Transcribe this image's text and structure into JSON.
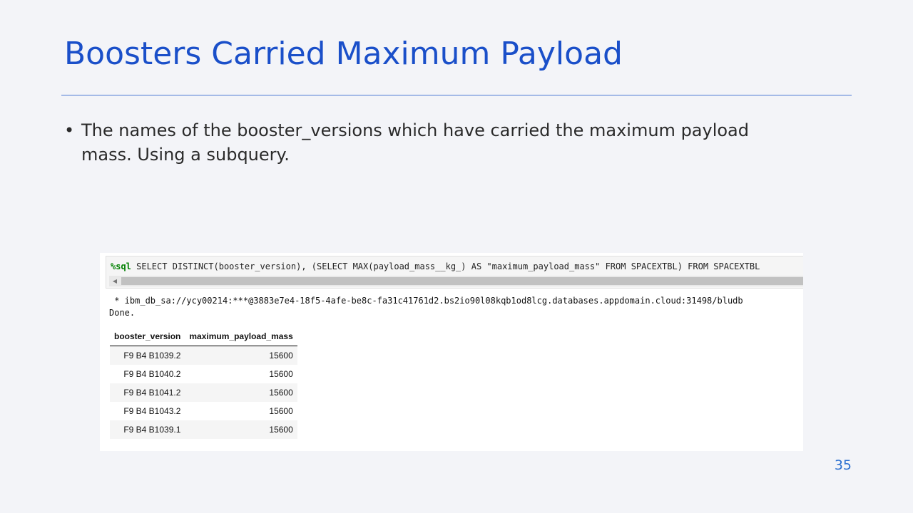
{
  "slide": {
    "title": "Boosters Carried Maximum Payload",
    "bullets": [
      "The names of the booster_versions which have carried the maximum payload mass. Using a subquery."
    ],
    "page_number": "35"
  },
  "notebook": {
    "code": {
      "magic": "%sql",
      "query": " SELECT DISTINCT(booster_version), (SELECT MAX(payload_mass__kg_) AS \"maximum_payload_mass\" FROM SPACEXTBL) FROM SPACEXTBL"
    },
    "output": {
      "connection": " * ibm_db_sa://ycy00214:***@3883e7e4-18f5-4afe-be8c-fa31c41761d2.bs2io90l08kqb1od8lcg.databases.appdomain.cloud:31498/bludb",
      "status": "Done."
    },
    "table": {
      "headers": [
        "booster_version",
        "maximum_payload_mass"
      ],
      "rows": [
        [
          "F9 B4 B1039.2",
          "15600"
        ],
        [
          "F9 B4 B1040.2",
          "15600"
        ],
        [
          "F9 B4 B1041.2",
          "15600"
        ],
        [
          "F9 B4 B1043.2",
          "15600"
        ],
        [
          "F9 B4 B1039.1",
          "15600"
        ]
      ]
    }
  }
}
